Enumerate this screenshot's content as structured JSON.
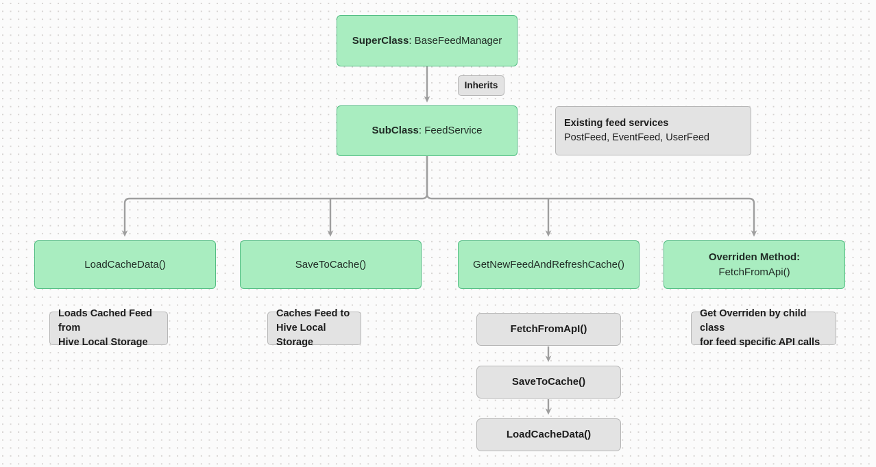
{
  "canvas": {
    "background": "#fbfbfb",
    "dot_color": "#d6d3d1",
    "title": "Feed Service Class Diagram"
  },
  "colors": {
    "green_fill": "#a9edc0",
    "green_border": "#53bd83",
    "grey_fill": "#e3e3e3",
    "grey_border": "#b6b6b6",
    "edge": "#9e9e9e",
    "text": "#1f2a24"
  },
  "nodes": {
    "superclass": {
      "label_strong": "SuperClass",
      "label_rest": ": BaseFeedManager"
    },
    "inherits_chip": {
      "label": "Inherits"
    },
    "subclass": {
      "label_strong": "SubClass",
      "label_rest": ": FeedService"
    },
    "existing_services_note": {
      "line1": "Existing feed services",
      "line2": "PostFeed, EventFeed, UserFeed"
    },
    "methods": [
      {
        "label": "LoadCacheData()"
      },
      {
        "label": "SaveToCache()"
      },
      {
        "label": "GetNewFeedAndRefreshCache()"
      }
    ],
    "overriden_method": {
      "title": "Overriden Method:",
      "subtitle": "FetchFromApi()"
    },
    "notes": [
      {
        "line1": "Loads Cached Feed from",
        "line2": "Hive Local Storage"
      },
      {
        "line1": "Caches Feed to",
        "line2": "Hive Local Storage"
      },
      {
        "line1": "Get Overriden by child class",
        "line2": "for feed specific API calls"
      }
    ],
    "chain": [
      {
        "label": "FetchFromApI()"
      },
      {
        "label": "SaveToCache()"
      },
      {
        "label": "LoadCacheData()"
      }
    ]
  }
}
